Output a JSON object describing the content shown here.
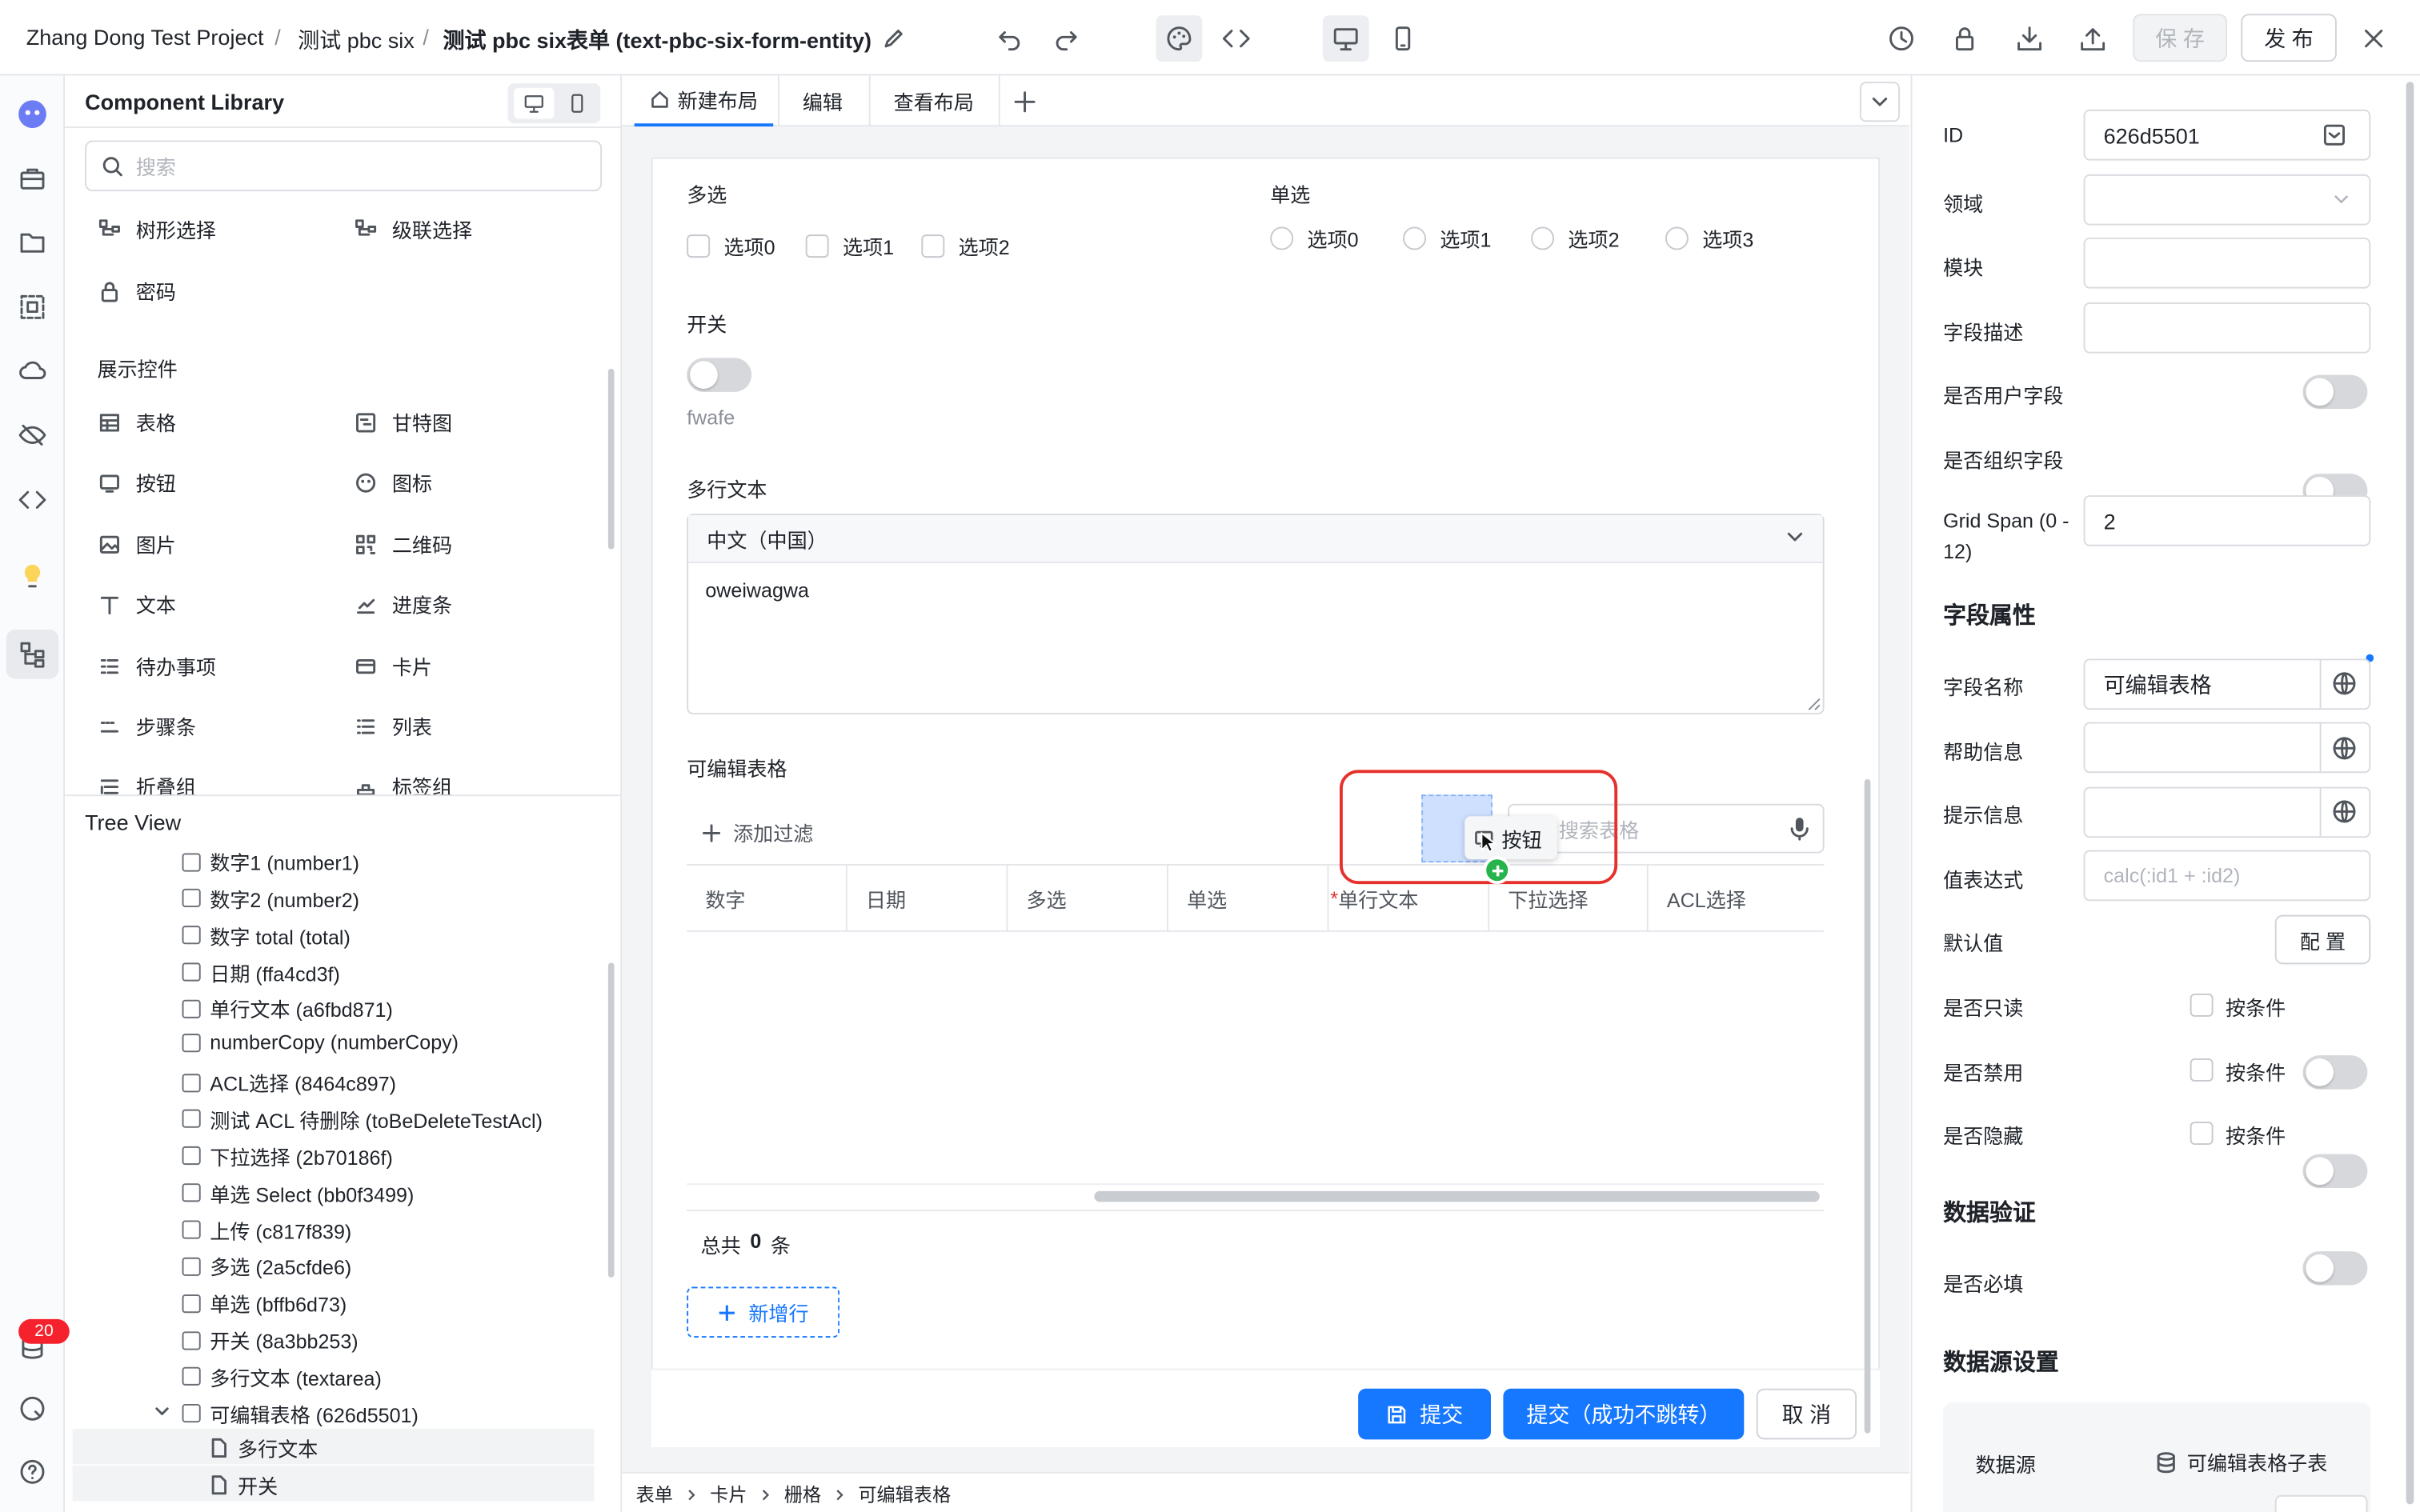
{
  "topbar": {
    "project": "Zhang Dong Test Project",
    "sep": "/",
    "app": "测试 pbc six",
    "form": "测试 pbc six表单 (text-pbc-six-form-entity)",
    "save_label": "保 存",
    "publish_label": "发 布"
  },
  "rail": {
    "badge": "20"
  },
  "library": {
    "title": "Component Library",
    "search_placeholder": "搜索",
    "top_items": [
      "树形选择",
      "级联选择",
      "密码"
    ],
    "display_section": "展示控件",
    "display_items": [
      "表格",
      "甘特图",
      "按钮",
      "图标",
      "图片",
      "二维码",
      "文本",
      "进度条",
      "待办事项",
      "卡片",
      "步骤条",
      "列表",
      "折叠组",
      "标签组"
    ]
  },
  "tree": {
    "title": "Tree View",
    "items": [
      "数字1 (number1)",
      "数字2 (number2)",
      "数字 total (total)",
      "日期 (ffa4cd3f)",
      "单行文本 (a6fbd871)",
      "numberCopy (numberCopy)",
      "ACL选择 (8464c897)",
      "测试 ACL 待删除 (toBeDeleteTestAcl)",
      "下拉选择 (2b70186f)",
      "单选 Select (bb0f3499)",
      "上传 (c817f839)",
      "多选 (2a5cfde6)",
      "单选 (bffb6d73)",
      "开关 (8a3bb253)",
      "多行文本 (textarea)",
      "可编辑表格 (626d5501)"
    ],
    "children": [
      "多行文本",
      "开关"
    ]
  },
  "canvas": {
    "tabs": [
      "新建布局",
      "编辑",
      "查看布局"
    ],
    "multi_label": "多选",
    "multi_options": [
      "选项0",
      "选项1",
      "选项2"
    ],
    "single_label": "单选",
    "single_options": [
      "选项0",
      "选项1",
      "选项2",
      "选项3"
    ],
    "switch_label": "开关",
    "switch_desc": "fwafe",
    "textarea_label": "多行文本",
    "textarea_lang": "中文（中国）",
    "textarea_value": "oweiwagwa",
    "table_label": "可编辑表格",
    "add_filter": "添加过滤",
    "table_search_placeholder": "搜索表格",
    "drag_tooltip": "按钮",
    "columns": [
      "数字",
      "日期",
      "多选",
      "单选",
      "单行文本",
      "下拉选择",
      "ACL选择"
    ],
    "total_prefix": "总共",
    "total_count": "0",
    "total_suffix": "条",
    "add_row": "新增行",
    "submit": "提交",
    "submit_stay": "提交（成功不跳转）",
    "cancel": "取 消",
    "breadcrumb": [
      "表单",
      "卡片",
      "栅格",
      "可编辑表格"
    ]
  },
  "props": {
    "id_label": "ID",
    "id_value": "626d5501",
    "domain_label": "领域",
    "module_label": "模块",
    "desc_label": "字段描述",
    "user_field_label": "是否用户字段",
    "org_field_label": "是否组织字段",
    "grid_span_label": "Grid Span (0 - 12)",
    "grid_span_value": "2",
    "field_props_title": "字段属性",
    "field_name_label": "字段名称",
    "field_name_value": "可编辑表格",
    "help_label": "帮助信息",
    "hint_label": "提示信息",
    "expr_label": "值表达式",
    "expr_placeholder": "calc(:id1 + :id2)",
    "default_label": "默认值",
    "config_button": "配 置",
    "readonly_label": "是否只读",
    "disabled_label": "是否禁用",
    "hidden_label": "是否隐藏",
    "by_condition": "按条件",
    "validation_title": "数据验证",
    "required_label": "是否必填",
    "datasource_title": "数据源设置",
    "datasource_label": "数据源",
    "datasource_value": "可编辑表格子表"
  },
  "colors": {
    "primary": "#1677ff",
    "highlight": "#e5312b",
    "badge": "#f5222d"
  }
}
